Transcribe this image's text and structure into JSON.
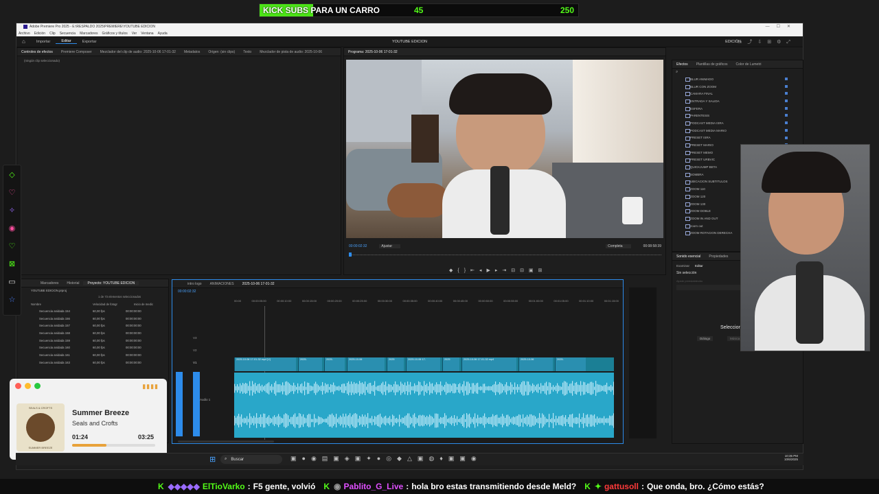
{
  "kick_banner": {
    "label": "KICK SUBS PARA UN CARRO",
    "current": "45",
    "goal": "250"
  },
  "window": {
    "title": "Adobe Premiere Pro 2025 - E:\\RESPALDO 2025\\PREMIERE\\YOUTUBE EDICION",
    "menu": [
      "Archivo",
      "Edición",
      "Clip",
      "Secuencia",
      "Marcadores",
      "Gráficos y títulos",
      "Ver",
      "Ventana",
      "Ayuda"
    ]
  },
  "appbar": {
    "tabs": [
      "Importar",
      "Editar",
      "Exportar"
    ],
    "active": "Editar",
    "project_title": "YOUTUBE EDICION",
    "workspace": "EDICIÓN"
  },
  "source_panel": {
    "tabs": [
      "Controles de efectos",
      "Premiere Composer",
      "Mezclador del clip de audio: 2025-10-06 17-01-32",
      "Metadatos",
      "Origen: (sin clips)",
      "Texto",
      "Mezclador de pista de audio: 2025-10-06"
    ],
    "empty_label": "(ningún clip seleccionado)"
  },
  "program_monitor": {
    "title": "Programa: 2025-10-06 17-01-32",
    "timecode": "00:00:02:32",
    "fit": "Ajustar",
    "quality": "Completa",
    "duration": "00:08:58:39"
  },
  "effects_panel": {
    "tabs": [
      "Efectos",
      "Plantillas de gráficos",
      "Color de Lumetri"
    ],
    "items": [
      "BLUR ANIMADO",
      "BLUR CON ZOOM",
      "CAMARA FINAL",
      "ENTRADA Y SALIDA",
      "ESFERA",
      "PARENTESIS",
      "PODCAST MEDIA ISRA",
      "PODCAST MEDIA MARIO",
      "PRESET ISRA",
      "PRESET MARIO",
      "PRESET MEMO",
      "PRESET URBVIC",
      "QUICKJUMP BETA",
      "SOMBRA",
      "UBICACION SUBTITULOS",
      "ZOOM 110",
      "ZOOM 120",
      "ZOOM 130",
      "ZOOM DOBLE",
      "ZOOM IN AND OUT",
      "zoom out",
      "ZOOM ROTACION DERECHA"
    ]
  },
  "essential_sound": {
    "tabs": [
      "Sonido esencial",
      "Propiedades"
    ],
    "subtabs": [
      "Examinar",
      "Editar"
    ],
    "no_selection": "Sin selección",
    "preset": "Ajuste preestablecido",
    "select_clips": "Selecciona clips",
    "dialog": "Diálogo",
    "music": "Música"
  },
  "project_panel": {
    "tabs": [
      "Marcadores",
      "Historial",
      "Proyecto: YOUTUBE EDICION"
    ],
    "file": "YOUTUBE EDICION.prproj",
    "count": "1 de 73 elementos seleccionados",
    "columns": [
      "Nombre",
      "Velocidad de fotogr",
      "Inicio de medic"
    ],
    "rows": [
      {
        "name": "Secuencia anidada 154",
        "fps": "60,00 fps",
        "start": "00:00:00:00"
      },
      {
        "name": "Secuencia anidada 156",
        "fps": "60,00 fps",
        "start": "00:00:00:00"
      },
      {
        "name": "Secuencia anidada 157",
        "fps": "60,00 fps",
        "start": "00:00:00:00"
      },
      {
        "name": "Secuencia anidada 158",
        "fps": "60,00 fps",
        "start": "00:00:00:00"
      },
      {
        "name": "Secuencia anidada 159",
        "fps": "60,00 fps",
        "start": "00:00:00:00"
      },
      {
        "name": "Secuencia anidada 160",
        "fps": "60,00 fps",
        "start": "00:00:00:00"
      },
      {
        "name": "Secuencia anidada 161",
        "fps": "60,00 fps",
        "start": "00:00:00:00"
      },
      {
        "name": "Secuencia anidada 163",
        "fps": "60,00 fps",
        "start": "00:00:00:00"
      }
    ]
  },
  "timeline": {
    "tabs": [
      "intro logo",
      "ANIMACIONES",
      "2025-10-06 17-01-32"
    ],
    "timecode": "00:00:02:32",
    "ruler": [
      "00:00",
      "00:00:05:00",
      "00:00:10:00",
      "00:00:15:00",
      "00:00:20:00",
      "00:00:25:00",
      "00:00:30:00",
      "00:00:35:00",
      "00:00:40:00",
      "00:00:45:00",
      "00:00:50:00",
      "00:00:55:00",
      "00:01:00:00",
      "00:01:05:00",
      "00:01:10:00",
      "00:01:15:00"
    ],
    "tracks": [
      "V3",
      "V2",
      "V1",
      "A1"
    ],
    "audio_name": "Audio 1",
    "clip_labels": [
      "2025-10-06 17-01-32.mp4 [V]",
      "2025-",
      "2025-",
      "2025-10-06",
      "2025",
      "2025-10-06 17-",
      "2025",
      "2025-10-06 17-01-32.mp4",
      "2025-10-06",
      "2025-"
    ]
  },
  "music_widget": {
    "title": "Summer Breeze",
    "artist": "Seals and Crofts",
    "elapsed": "01:24",
    "total": "03:25",
    "progress": 0.41,
    "album_top": "SEALS & CROFTS",
    "album_bottom": "SUMMER BREEZE"
  },
  "taskbar": {
    "search": "Buscar",
    "time": "10:35 PM",
    "date": "10/6/2025"
  },
  "chat": [
    {
      "user": "ElTioVarko",
      "msg": "F5 gente, volvió"
    },
    {
      "user": "Pablito_G_Live",
      "msg": "hola bro  estas transmitiendo desde Meld?"
    },
    {
      "user": "gattusoll",
      "msg": "Que onda, bro. ¿Cómo estás?"
    }
  ]
}
